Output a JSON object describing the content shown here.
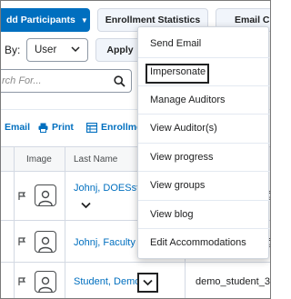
{
  "toolbar": {
    "add_participants_label": "dd Participants",
    "enrollment_statistics_label": "Enrollment Statistics",
    "email_classlist_label": "Email Clas"
  },
  "filter": {
    "by_label": "By:",
    "view_by_value": "User",
    "apply_label": "Apply"
  },
  "search": {
    "placeholder": "rch For..."
  },
  "actions": {
    "email_label": "Email",
    "print_label": "Print",
    "enrollment_label": "Enrollment"
  },
  "table": {
    "headers": {
      "image": "Image",
      "last_name": "Last Name"
    },
    "rows": [
      {
        "name": "Johnj, DOESstu",
        "email": "@"
      },
      {
        "name": "Johnj, Faculty",
        "email": "@"
      },
      {
        "name": "Student, Demo",
        "email": "demo_student_38"
      }
    ]
  },
  "context_menu": {
    "items": [
      "Send Email",
      "Impersonate",
      "Manage Auditors",
      "View Auditor(s)",
      "View progress",
      "View groups",
      "View blog",
      "Edit Accommodations"
    ],
    "highlighted_item": "Impersonate"
  },
  "colors": {
    "primary": "#006fbf",
    "link": "#006fbf",
    "border": "#d3d9e3"
  }
}
